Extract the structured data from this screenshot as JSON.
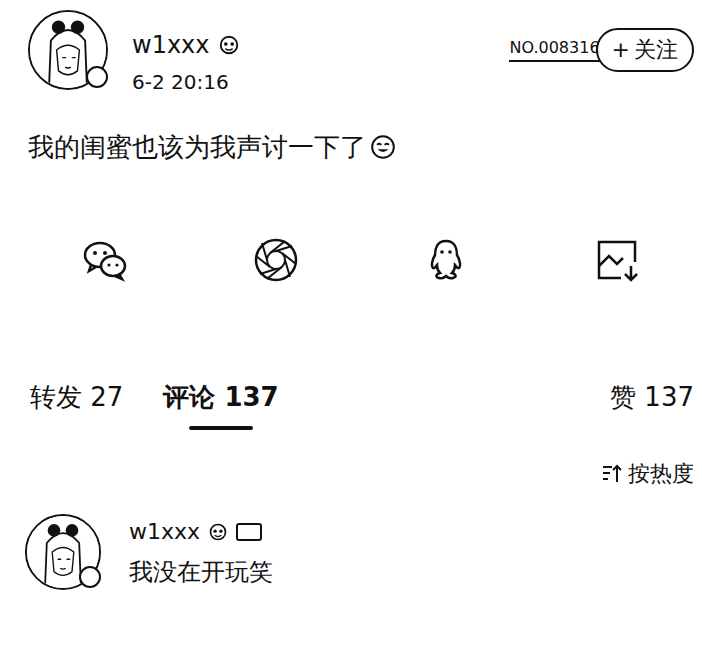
{
  "post": {
    "author": "w1xxx",
    "time": "6-2 20:16",
    "serial": "NO.008316",
    "follow_icon": "+",
    "follow_label": "关注",
    "text": "我的闺蜜也该为我声讨一下了"
  },
  "tabs": [
    {
      "label": "转发",
      "count": "27",
      "selected": false
    },
    {
      "label": "评论",
      "count": "137",
      "selected": true
    }
  ],
  "likes": {
    "label": "赞",
    "count": "137"
  },
  "sort": {
    "label": "按热度"
  },
  "comments": [
    {
      "author": "w1xxx",
      "text": "我没在开玩笑"
    }
  ]
}
